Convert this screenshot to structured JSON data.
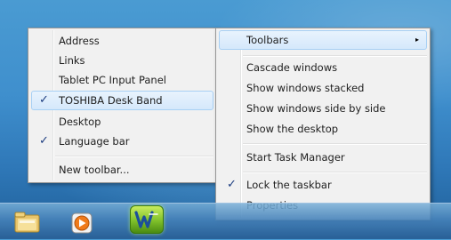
{
  "submenu": {
    "items": [
      {
        "label": "Address",
        "checked": false
      },
      {
        "label": "Links",
        "checked": false
      },
      {
        "label": "Tablet PC Input Panel",
        "checked": false
      },
      {
        "label": "TOSHIBA Desk Band",
        "checked": true,
        "highlighted": true
      },
      {
        "label": "Desktop",
        "checked": false
      },
      {
        "label": "Language bar",
        "checked": true
      },
      {
        "label": "New toolbar...",
        "checked": false
      }
    ],
    "check_glyph": "✓"
  },
  "context_menu": {
    "toolbars_label": "Toolbars",
    "submenu_arrow": "▸",
    "cascade_label": "Cascade windows",
    "stacked_label": "Show windows stacked",
    "side_by_side_label": "Show windows side by side",
    "show_desktop_label": "Show the desktop",
    "task_manager_label": "Start Task Manager",
    "lock_taskbar_label": "Lock the taskbar",
    "lock_taskbar_checked": true,
    "properties_label": "Properties",
    "check_glyph": "✓"
  },
  "taskbar": {
    "pinned": [
      {
        "icon": "folder-icon"
      },
      {
        "icon": "media-player-icon"
      },
      {
        "icon": "wizard-app-icon"
      }
    ]
  },
  "colors": {
    "menu_bg": "#f1f1f1",
    "highlight": "#d5e8fb",
    "checkmark": "#1d3d80"
  }
}
